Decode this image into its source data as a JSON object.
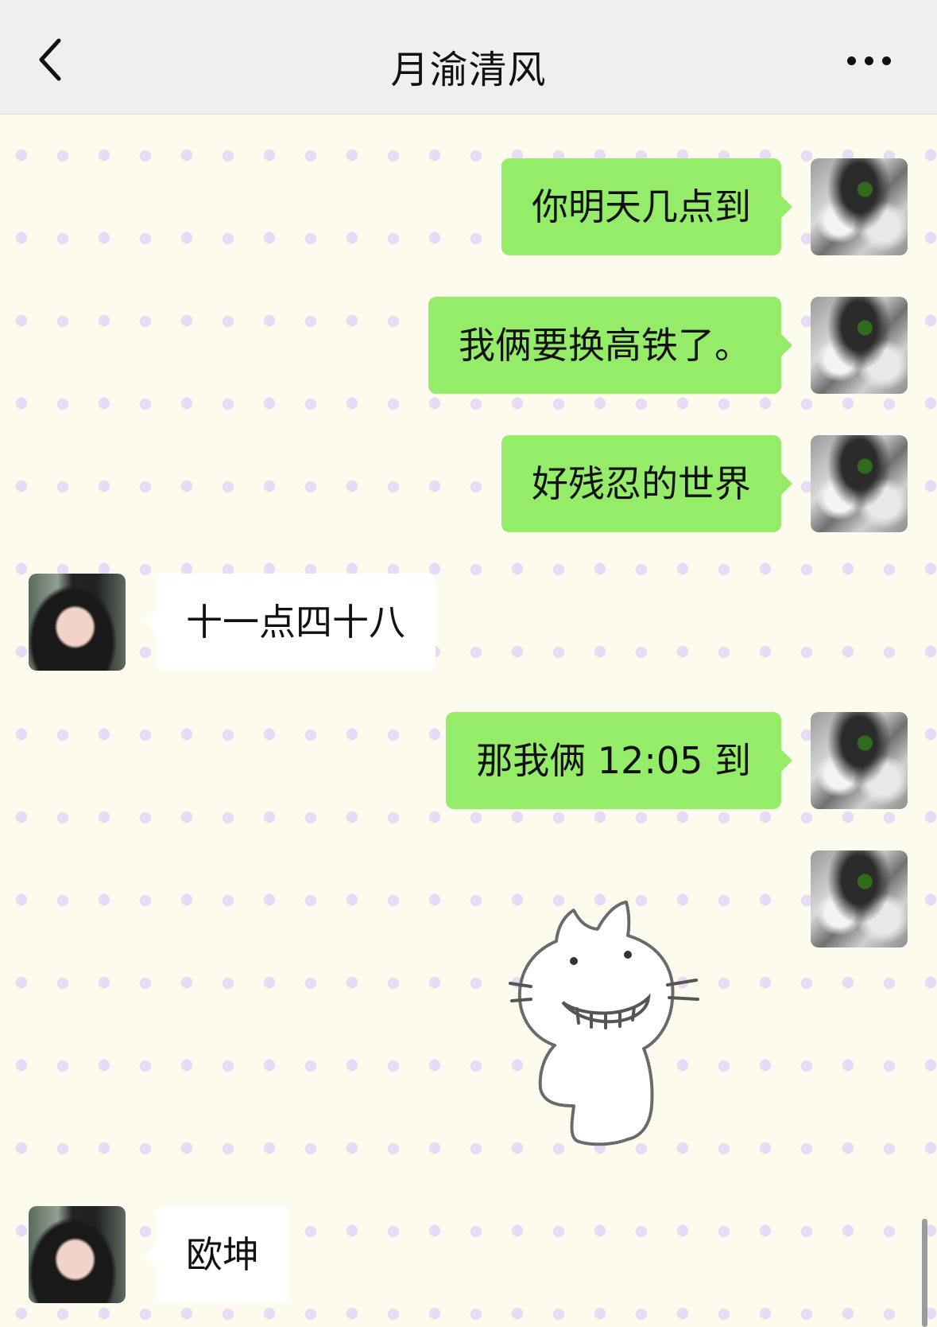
{
  "header": {
    "title": "月渝清风",
    "back_icon": "chevron-left-icon",
    "more_icon": "more-dots-icon"
  },
  "messages": [
    {
      "side": "out",
      "text": "你明天几点到"
    },
    {
      "side": "out",
      "text": "我俩要换高铁了。"
    },
    {
      "side": "out",
      "text": "好残忍的世界"
    },
    {
      "side": "in",
      "text": "十一点四十八"
    },
    {
      "side": "out",
      "text": "那我俩 12:05 到"
    },
    {
      "side": "out",
      "type": "sticker",
      "sticker": "grinning-cat-sticker"
    },
    {
      "side": "in",
      "text": "欧坤"
    }
  ],
  "colors": {
    "outgoing_bubble": "#95ec69",
    "incoming_bubble": "#ffffff",
    "background": "#fdfaee",
    "dot": "#e8dcf5"
  }
}
